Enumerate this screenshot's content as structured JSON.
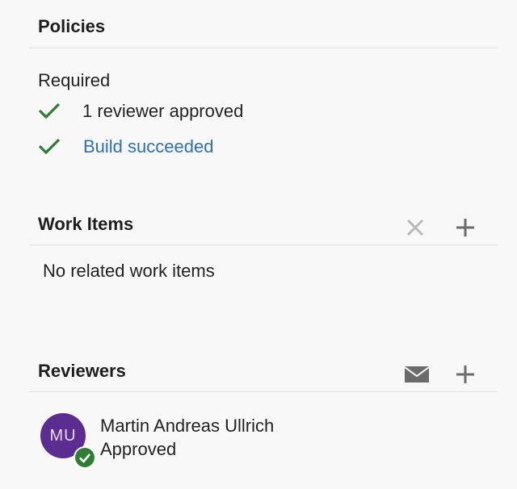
{
  "policies": {
    "title": "Policies",
    "required_label": "Required",
    "items": [
      {
        "label": "1 reviewer approved",
        "status": "passed"
      },
      {
        "label": "Build succeeded",
        "status": "passed"
      }
    ]
  },
  "work_items": {
    "title": "Work Items",
    "empty_text": "No related work items"
  },
  "reviewers": {
    "title": "Reviewers",
    "list": [
      {
        "name": "Martin Andreas Ullrich",
        "initials": "MU",
        "vote": "Approved"
      }
    ]
  },
  "colors": {
    "check_green": "#2e7d32",
    "link_blue": "#2f70b5",
    "avatar_purple": "#5c2d91"
  },
  "icons": {
    "check": "check-icon",
    "remove": "close-icon",
    "add": "plus-icon",
    "email": "mail-icon",
    "approved_badge": "check-circle-icon"
  }
}
